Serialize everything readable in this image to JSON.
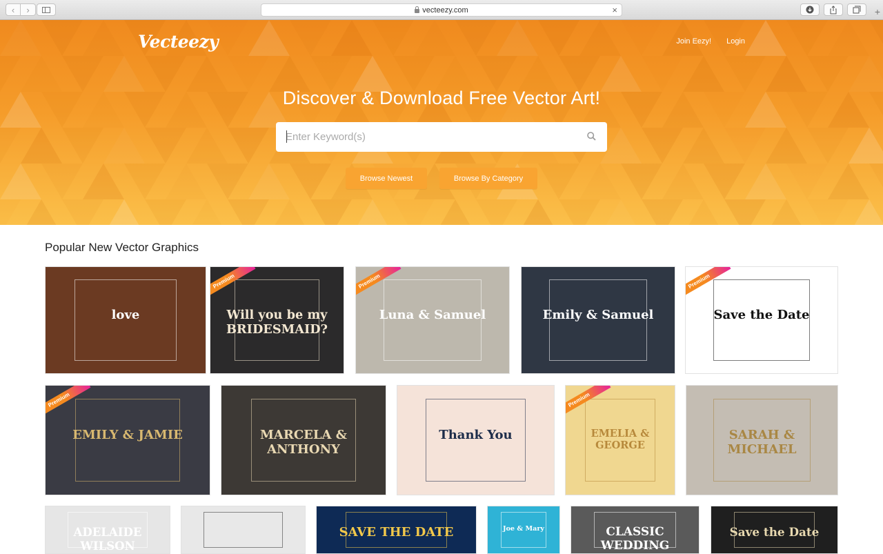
{
  "browser": {
    "url": "vecteezy.com",
    "back_icon": "chevron-left-icon",
    "forward_icon": "chevron-right-icon"
  },
  "header": {
    "logo": "Vecteezy",
    "nav": {
      "join": "Join Eezy!",
      "login": "Login"
    }
  },
  "hero": {
    "title": "Discover & Download Free Vector Art!",
    "search_placeholder": "Enter Keyword(s)",
    "browse_newest": "Browse Newest",
    "browse_category": "Browse By Category"
  },
  "gallery": {
    "title": "Popular New Vector Graphics",
    "premium_label": "Premium",
    "tiles": [
      {
        "premium": false,
        "bg": "#6b3a22",
        "text": "love",
        "fg": "#ffffff"
      },
      {
        "premium": true,
        "bg": "#2b2a2b",
        "text": "Will you be my BRIDESMAID?",
        "fg": "#f4e8d2"
      },
      {
        "premium": true,
        "bg": "#bdb8ad",
        "text": "Luna & Samuel",
        "fg": "#ffffff"
      },
      {
        "premium": false,
        "bg": "#2f3744",
        "text": "Emily & Samuel",
        "fg": "#ffffff"
      },
      {
        "premium": true,
        "bg": "#ffffff",
        "text": "Save the Date",
        "fg": "#111111"
      },
      {
        "premium": true,
        "bg": "#3a3b44",
        "text": "EMILY & JAMIE",
        "fg": "#d8b870"
      },
      {
        "premium": false,
        "bg": "#3d3935",
        "text": "MARCELA & ANTHONY",
        "fg": "#e9d8b2"
      },
      {
        "premium": false,
        "bg": "#f5e3d9",
        "text": "Thank You",
        "fg": "#1d2d4a"
      },
      {
        "premium": true,
        "bg": "#f0d790",
        "text": "EMELIA & GEORGE",
        "fg": "#b7893b"
      },
      {
        "premium": false,
        "bg": "#c4bdb3",
        "text": "SARAH & MICHAEL",
        "fg": "#a98744"
      },
      {
        "premium": false,
        "bg": "#e6e6e6",
        "text": "ADELAIDE WILSON",
        "fg": "#ffffff"
      },
      {
        "premium": false,
        "bg": "#e8e8e8",
        "text": "",
        "fg": "#333333"
      },
      {
        "premium": false,
        "bg": "#0e2a55",
        "text": "SAVE THE DATE",
        "fg": "#f2c84a"
      },
      {
        "premium": false,
        "bg": "#2fb3d6",
        "text": "Joe & Mary",
        "fg": "#ffffff"
      },
      {
        "premium": false,
        "bg": "#5a5a5a",
        "text": "CLASSIC WEDDING INVITATION",
        "fg": "#ffffff"
      },
      {
        "premium": false,
        "bg": "#1f1f1f",
        "text": "Save the Date",
        "fg": "#e8d9b0"
      }
    ]
  },
  "colors": {
    "hero_top": "#f08a1e",
    "hero_bottom": "#fbc04a",
    "button": "#f9a431"
  }
}
